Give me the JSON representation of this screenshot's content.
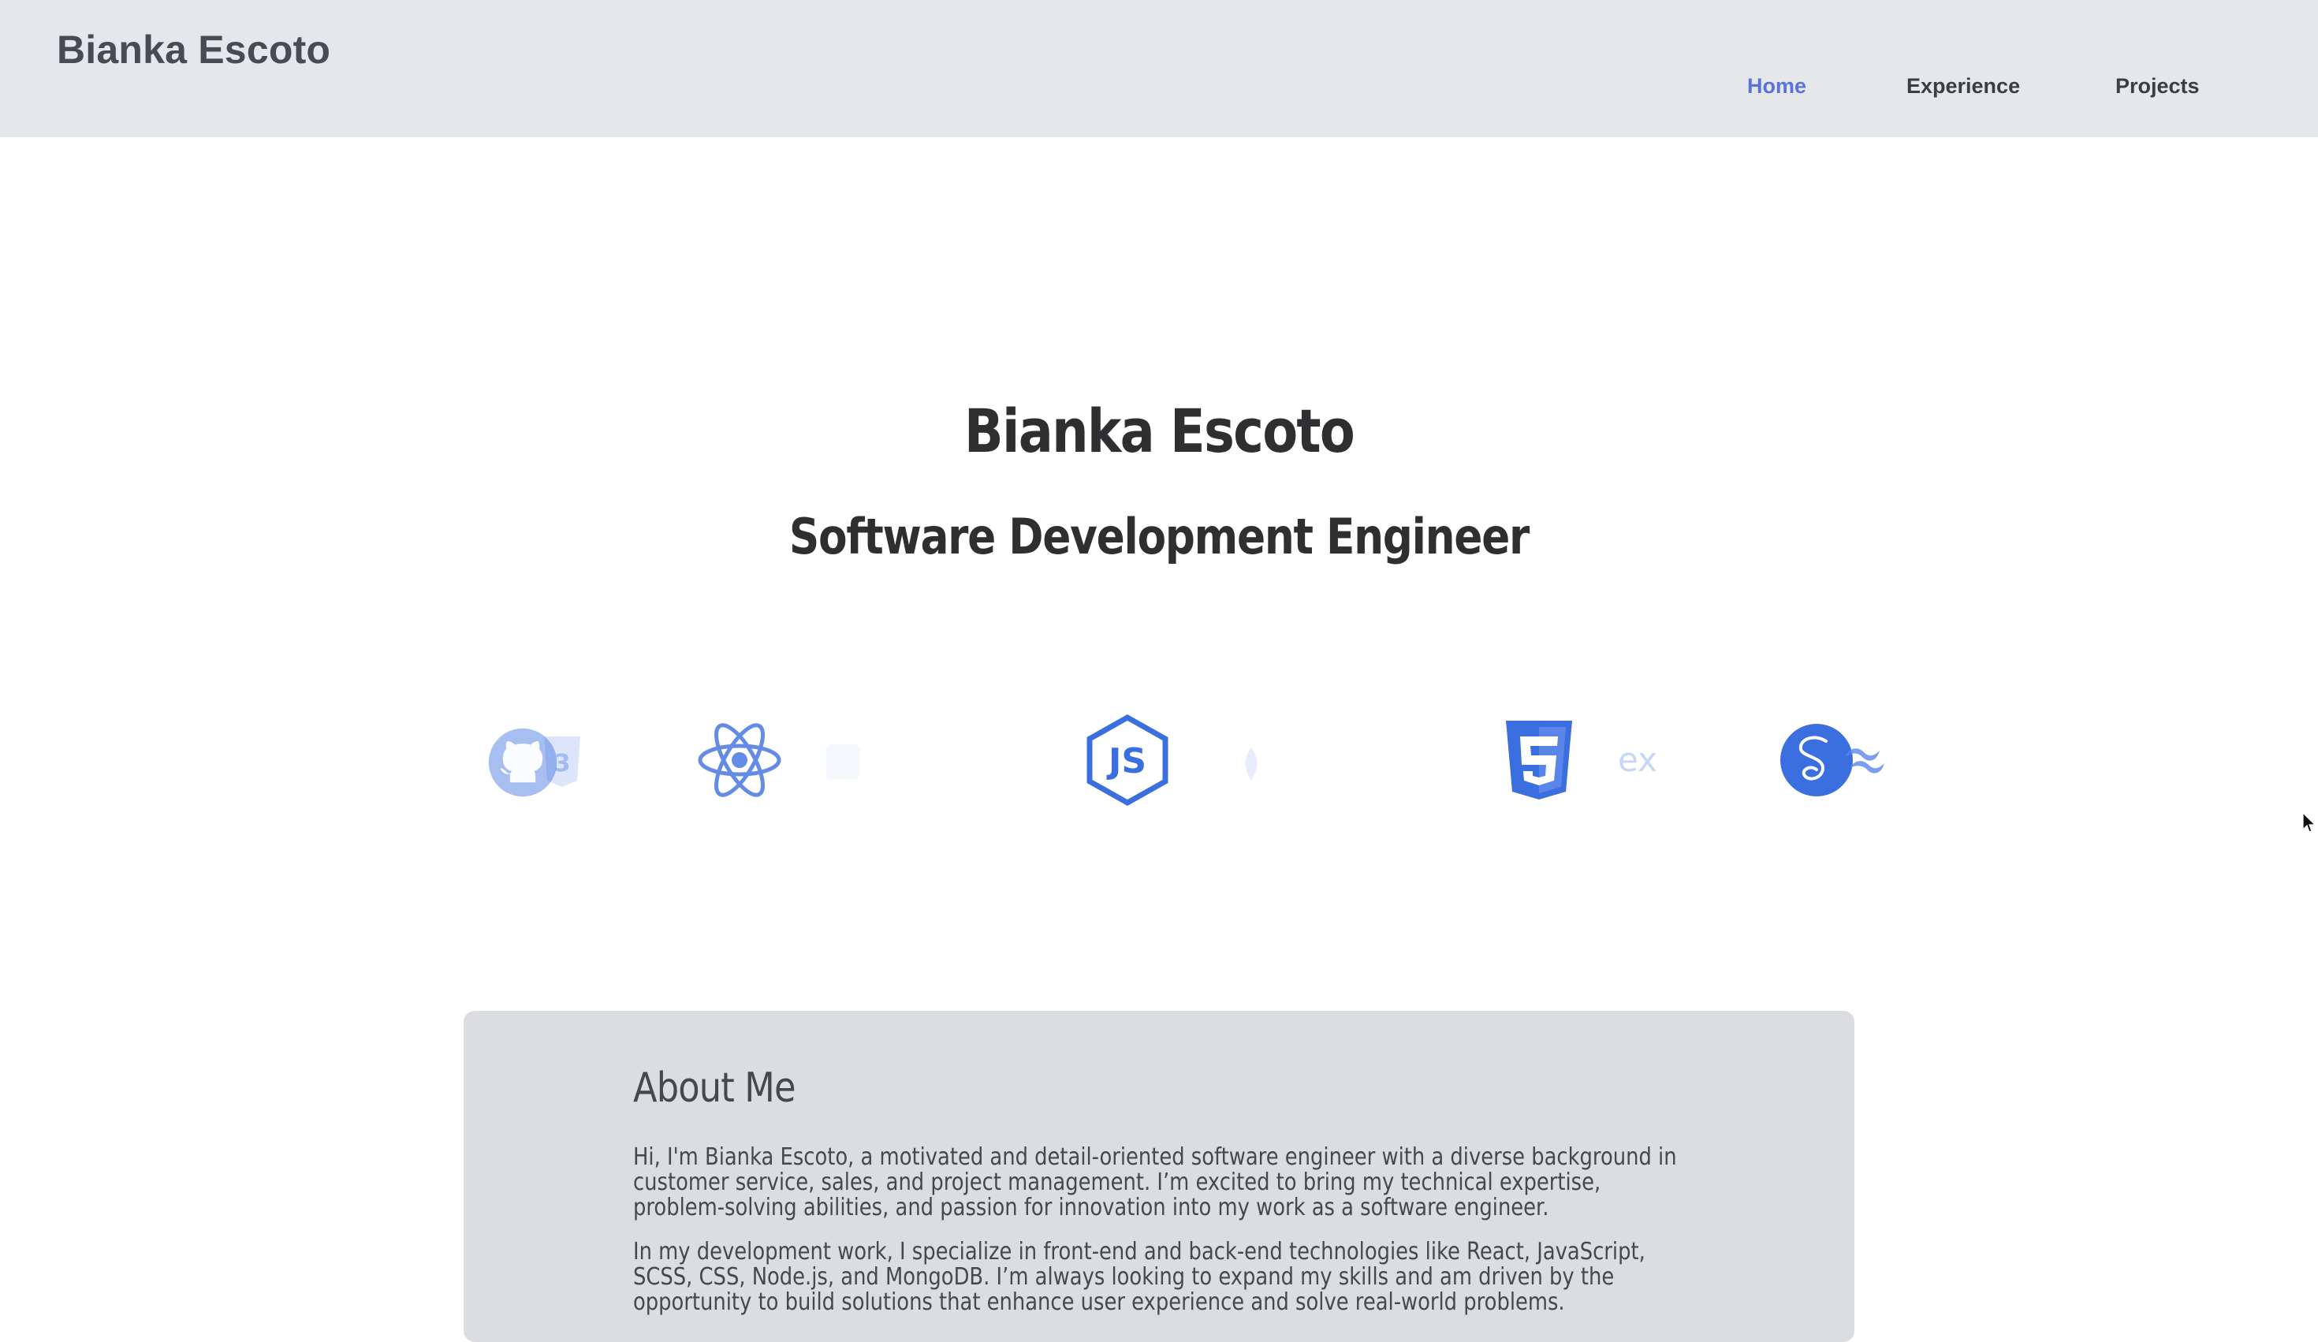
{
  "header": {
    "brand": "Bianka Escoto",
    "nav": [
      {
        "label": "Home",
        "active": true
      },
      {
        "label": "Experience",
        "active": false
      },
      {
        "label": "Projects",
        "active": false
      }
    ]
  },
  "hero": {
    "name": "Bianka Escoto",
    "title": "Software Development Engineer"
  },
  "tech_icons": [
    "github-icon",
    "css3-icon",
    "react-icon",
    "nodejs-icon",
    "mongodb-icon",
    "html5-icon",
    "express-icon",
    "sass-icon",
    "tailwind-icon"
  ],
  "about": {
    "heading": "About Me",
    "paragraphs": [
      "Hi, I'm Bianka Escoto, a motivated and detail-oriented software engineer with a diverse background in customer service, sales, and project management. I’m excited to bring my technical expertise, problem-solving abilities, and passion for innovation into my work as a software engineer.",
      "In my development work, I specialize in front-end and back-end technologies like React, JavaScript, SCSS, CSS, Node.js, and MongoDB. I’m always looking to expand my skills and am driven by the opportunity to build solutions that enhance user experience and solve real-world problems."
    ]
  },
  "colors": {
    "header_bg": "#e5e7eb",
    "nav_active": "#5a73d6",
    "icon_blue": "#3b6fe0",
    "card_bg": "#dcdde0"
  }
}
